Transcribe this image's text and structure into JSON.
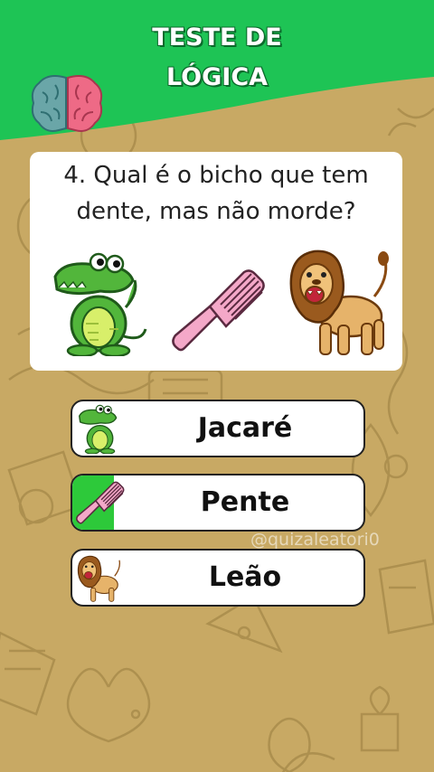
{
  "header": {
    "title_line1": "TESTE DE",
    "title_line2": "LÓGICA",
    "brain_icon": "brain-icon",
    "color_green": "#1ec455"
  },
  "question": {
    "text_line1": "4. Qual é o bicho que tem",
    "text_line2": "dente, mas não morde?",
    "pictures": [
      "crocodile-icon",
      "comb-icon",
      "lion-icon"
    ]
  },
  "options": [
    {
      "label": "Jacaré",
      "icon": "crocodile-icon",
      "correct": false
    },
    {
      "label": "Pente",
      "icon": "comb-icon",
      "correct": true
    },
    {
      "label": "Leão",
      "icon": "lion-icon",
      "correct": false
    }
  ],
  "watermark": "@quizaleatori0",
  "colors": {
    "background": "#c8a964",
    "correct": "#2dc93a",
    "card": "#ffffff"
  }
}
